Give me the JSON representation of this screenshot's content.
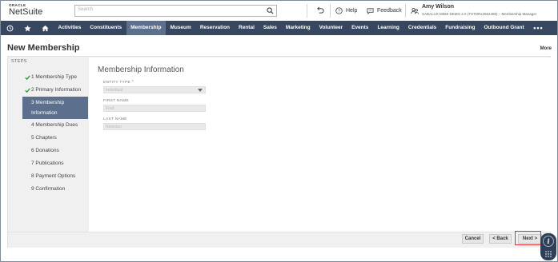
{
  "header": {
    "logo_top": "ORACLE",
    "logo_bottom": "NetSuite",
    "search_placeholder": "Search",
    "help_label": "Help",
    "feedback_label": "Feedback",
    "user_name": "Amy Wilson",
    "user_role": "SABALUX M360 DEMO 2.0 (TSTDRx2662489) – Membership Manager"
  },
  "nav": {
    "items": [
      "Activities",
      "Constituents",
      "Membership",
      "Museum",
      "Reservation",
      "Rental",
      "Sales",
      "Marketing",
      "Volunteer",
      "Events",
      "Learning",
      "Credentials",
      "Fundraising",
      "Outbound Grant"
    ],
    "active": "Membership",
    "more": "•••"
  },
  "page": {
    "title": "New Membership",
    "more_label": "More"
  },
  "steps": {
    "label": "STEPS",
    "items": [
      {
        "label": "1 Membership Type",
        "state": "done"
      },
      {
        "label": "2 Primary Information",
        "state": "done"
      },
      {
        "label": "3 Membership",
        "label2": "Information",
        "state": "active"
      },
      {
        "label": "4 Membership Dues",
        "state": "pending"
      },
      {
        "label": "5 Chapters",
        "state": "pending"
      },
      {
        "label": "6 Donations",
        "state": "pending"
      },
      {
        "label": "7 Publications",
        "state": "pending"
      },
      {
        "label": "8 Payment Options",
        "state": "pending"
      },
      {
        "label": "9 Confirmation",
        "state": "pending"
      }
    ]
  },
  "form": {
    "section_title": "Membership Information",
    "entity_type_label": "ENTITY TYPE",
    "entity_type_required": "*",
    "entity_type_value": "Individual",
    "first_name_label": "FIRST NAME",
    "first_name_value": "Fred",
    "last_name_label": "LAST NAME",
    "last_name_value": "Newman"
  },
  "buttons": {
    "cancel": "Cancel",
    "back": "< Back",
    "next": "Next >"
  },
  "colors": {
    "nav_bg": "#37475f",
    "nav_active": "#5c6f8d",
    "highlight": "#e32d2d",
    "check": "#2e9e2e"
  }
}
